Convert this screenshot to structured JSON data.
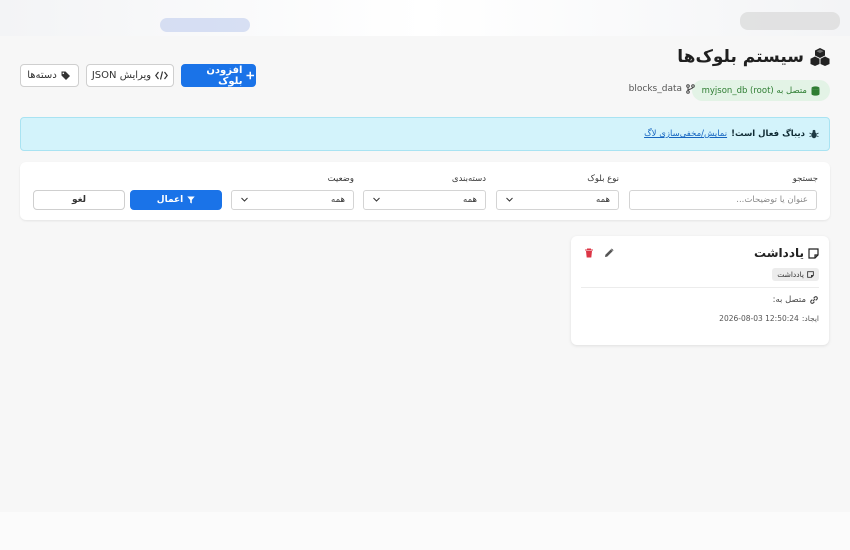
{
  "header": {
    "title": "سیستم بلوک‌ها",
    "db_connection": "متصل به myjson_db (root)",
    "table_name": "blocks_data"
  },
  "toolbar": {
    "add_block": "افزودن بلوک",
    "edit_json": "ویرایش JSON",
    "categories": "دسته‌ها"
  },
  "alert": {
    "bold_text": "دیباگ فعال است!",
    "link_text": "نمایش/مخفی‌سازی لاگ"
  },
  "filters": {
    "search_label": "جستجو",
    "search_placeholder": "عنوان یا توضیحات...",
    "type_label": "نوع بلوک",
    "type_value": "همه",
    "category_label": "دسته‌بندی",
    "category_value": "همه",
    "status_label": "وضعیت",
    "status_value": "همه",
    "apply": "اعمال",
    "reset": "لغو"
  },
  "blocks": [
    {
      "title": "یادداشت",
      "type": "یادداشت",
      "linked_label": "متصل به:",
      "created_label": "ایجاد:",
      "created_value": "2026-08-03 12:50:24"
    }
  ],
  "colors": {
    "primary": "#1a73e8",
    "alert_bg": "#d3f3fb",
    "db_badge_bg": "#e3f3e6",
    "db_badge_text": "#2e7d32",
    "delete": "#dc3545"
  },
  "icons": [
    "cubes-icon",
    "database-icon",
    "branch-icon",
    "plus-icon",
    "code-icon",
    "tags-icon",
    "bug-icon",
    "filter-icon",
    "sticky-note-icon",
    "pencil-icon",
    "trash-icon",
    "link-icon",
    "chevron-down-icon"
  ]
}
